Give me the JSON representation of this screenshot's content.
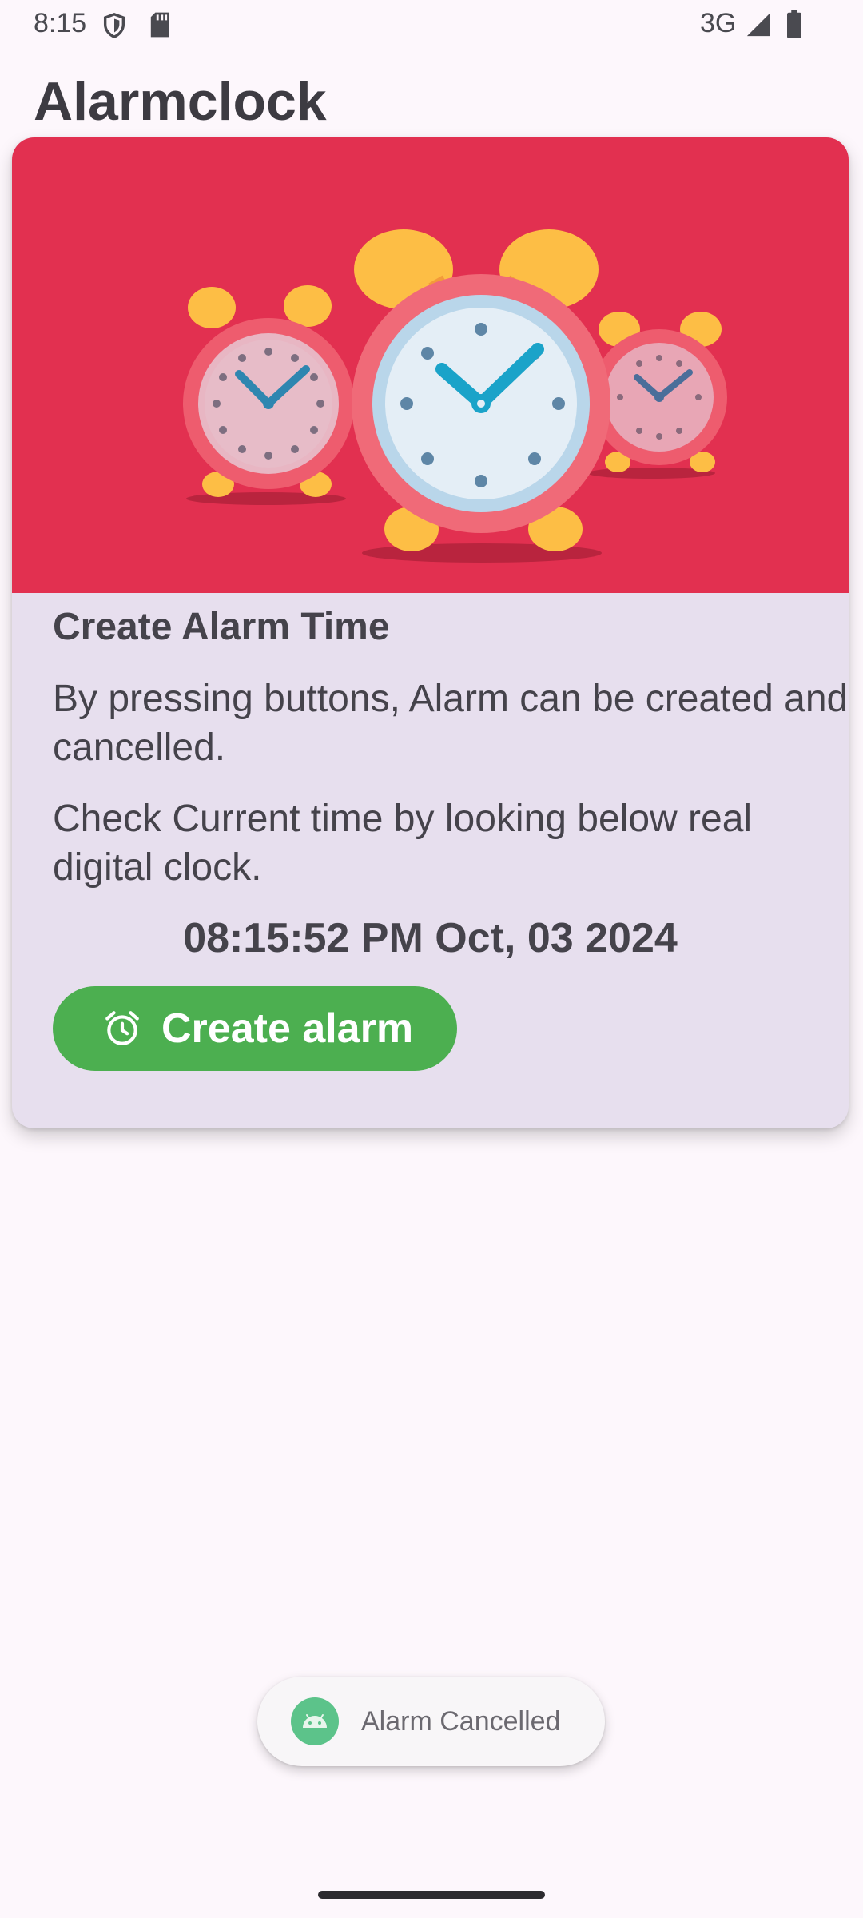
{
  "status_bar": {
    "time": "8:15",
    "network": "3G",
    "icons": [
      "shield-icon",
      "sd-card-icon",
      "signal-icon",
      "battery-icon"
    ]
  },
  "app": {
    "title": "Alarmclock"
  },
  "card": {
    "image": "alarm-clocks-illustration",
    "heading": "Create Alarm Time",
    "description": "By pressing buttons, Alarm can be created and cancelled.",
    "clock_hint": "Check Current time by looking below real digital clock.",
    "digital_clock": "08:15:52 PM Oct, 03 2024",
    "create_button_label": "Create alarm",
    "create_button_icon": "alarm-clock-icon"
  },
  "toast": {
    "icon": "android-icon",
    "message": "Alarm Cancelled"
  },
  "colors": {
    "background": "#FDF7FC",
    "card": "#E7DFEE",
    "hero": "#E23050",
    "button": "#4CAF50"
  }
}
